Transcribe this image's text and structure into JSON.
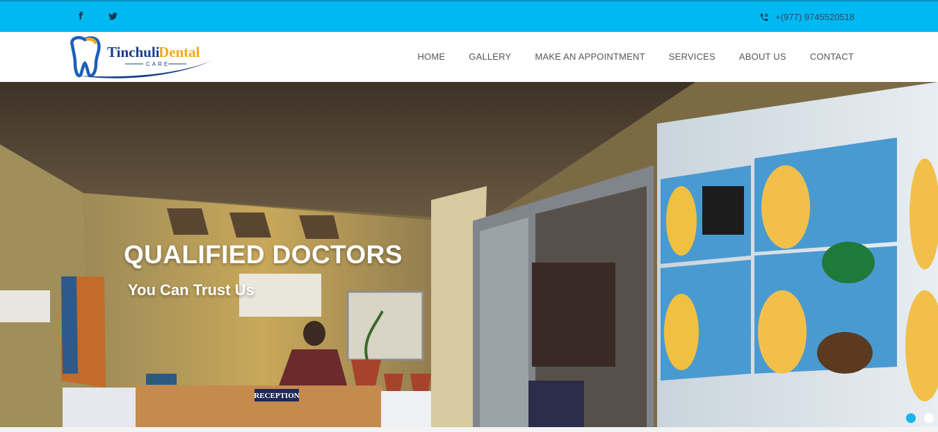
{
  "topbar": {
    "facebook_glyph": "f",
    "twitter_glyph": "🐦",
    "phone": "+(977) 9745520518"
  },
  "logo": {
    "name_part1": "Tinchuli",
    "name_part2": "Dental",
    "tagline": "CARE"
  },
  "nav": {
    "items": [
      "HOME",
      "GALLERY",
      "MAKE AN APPOINTMENT",
      "SERVICES",
      "ABOUT US",
      "CONTACT"
    ]
  },
  "hero": {
    "title": "QUALIFIED DOCTORS",
    "subtitle": "You Can Trust Us",
    "reception_sign": "RECEPTION",
    "slides_total": 2,
    "active_slide": 1
  },
  "colors": {
    "topbar": "#00b9f2",
    "accent": "#17b5ec",
    "logo_blue": "#1b4fa3",
    "logo_orange": "#f4a81d"
  },
  "icons": [
    "facebook-icon",
    "twitter-icon",
    "phone-icon",
    "logo-tooth-icon"
  ]
}
